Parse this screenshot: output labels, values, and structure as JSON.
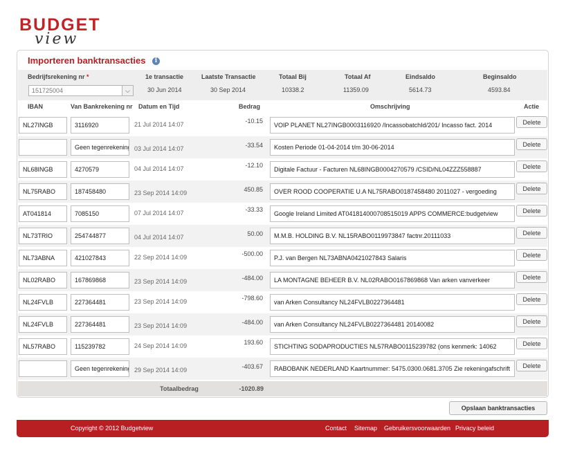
{
  "logo": {
    "word1": "BUDGET",
    "word2": "view"
  },
  "panel": {
    "title": "Importeren banktransacties",
    "info_icon": "i"
  },
  "summary": {
    "headers": {
      "account": "Bedrijfsrekening nr",
      "required_mark": "*",
      "first": "1e transactie",
      "last": "Laatste Transactie",
      "total_bij": "Totaal Bij",
      "total_af": "Totaal Af",
      "end_balance": "Eindsaldo",
      "begin_balance": "Beginsaldo"
    },
    "account_value": "151725004",
    "first": "30 Jun 2014",
    "last": "30 Sep 2014",
    "total_bij": "10338.2",
    "total_af": "11359.09",
    "end_balance": "5614.73",
    "begin_balance": "4593.84"
  },
  "columns": {
    "iban": "IBAN",
    "counter_account": "Van Bankrekening nr",
    "datetime": "Datum en Tijd",
    "amount": "Bedrag",
    "description": "Omschrijving",
    "action": "Actie"
  },
  "rows": [
    {
      "iban": "NL27INGB",
      "account": "3116920",
      "datetime": "21 Jul 2014 14:07",
      "amount": "-10.15",
      "description": "VOIP PLANET  NL27INGB0003116920  /IncassobatchId/201/ Incasso fact. 2014"
    },
    {
      "iban": "",
      "account": "Geen tegenrekening",
      "datetime": "03 Jul 2014 14:07",
      "amount": "-33.54",
      "description": "Kosten    Periode 01-04-2014 t/m 30-06-2014"
    },
    {
      "iban": "NL68INGB",
      "account": "4270579",
      "datetime": "04 Jul 2014 14:07",
      "amount": "-12.10",
      "description": "Digitale Factuur - Facturen  NL68INGB0004270579   /CSID/NL04ZZZ558887"
    },
    {
      "iban": "NL75RABO",
      "account": "187458480",
      "datetime": "23 Sep 2014 14:09",
      "amount": "450.85",
      "description": "OVER ROOD COOPERATIE U.A  NL75RABO0187458480  2011027 - vergoeding"
    },
    {
      "iban": "AT041814",
      "account": "7085150",
      "datetime": "07 Jul 2014 14:07",
      "amount": "-33.33",
      "description": "Google Ireland Limited  AT041814000708515019  APPS COMMERCE:budgetview"
    },
    {
      "iban": "NL73TRIO",
      "account": "254744877",
      "datetime": "04 Jul 2014 14:07",
      "amount": "50.00",
      "description": " M.M.B. HOLDING B.V.  NL15RABO0119973847  factnr.20111033"
    },
    {
      "iban": "NL73ABNA",
      "account": "421027843",
      "datetime": "22 Sep 2014 14:09",
      "amount": "-500.00",
      "description": "P.J. van Bergen  NL73ABNA0421027843  Salaris"
    },
    {
      "iban": "NL02RABO",
      "account": "167869868",
      "datetime": "23 Sep 2014 14:09",
      "amount": "-484.00",
      "description": "LA MONTAGNE BEHEER B.V.  NL02RABO0167869868  Van arken vanverkeer"
    },
    {
      "iban": "NL24FVLB",
      "account": "227364481",
      "datetime": "23 Sep 2014 14:09",
      "amount": "-798.60",
      "description": "van Arken Consultancy  NL24FVLB0227364481"
    },
    {
      "iban": "NL24FVLB",
      "account": "227364481",
      "datetime": "23 Sep 2014 14:09",
      "amount": "-484.00",
      "description": "van Arken Consultancy  NL24FVLB0227364481  20140082"
    },
    {
      "iban": "NL57RABO",
      "account": "115239782",
      "datetime": "24 Sep 2014 14:09",
      "amount": "193.60",
      "description": "STICHTING SODAPRODUCTIES  NL57RABO0115239782  (ons kenmerk: 14062"
    },
    {
      "iban": "",
      "account": "Geen tegenrekening",
      "datetime": "29 Sep 2014 14:09",
      "amount": "-403.67",
      "description": "RABOBANK NEDERLAND     Kaartnummer: 5475.0300.0681.3705 Zie rekeningafschrift"
    }
  ],
  "delete_label": "Delete",
  "total": {
    "label": "Totaalbedrag",
    "value": "-1020.89"
  },
  "save_label": "Opslaan banktransacties",
  "footer": {
    "copyright": "Copyright © 2012 Budgetview",
    "links": [
      "Contact",
      "Sitemap",
      "Gebruikersvoorwaarden",
      "Privacy beleid"
    ]
  },
  "colors": {
    "brand": "#b81f23",
    "info": "#5d84b6"
  },
  "icons": {
    "info": "info-icon",
    "dropdown": "chevron-down-icon"
  }
}
